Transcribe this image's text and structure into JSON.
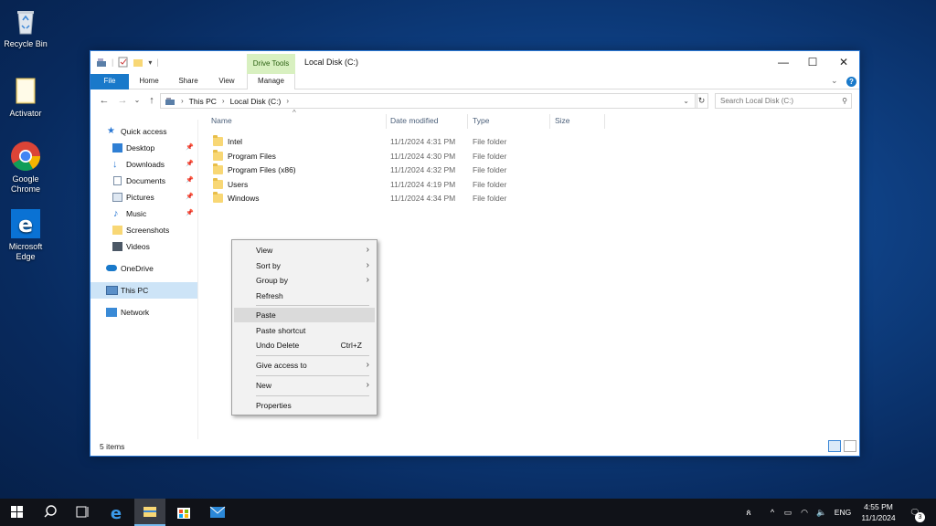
{
  "desktop": {
    "icons": [
      {
        "label": "Recycle Bin"
      },
      {
        "label": "Activator"
      },
      {
        "label": "Google Chrome"
      },
      {
        "label": "Microsoft Edge"
      }
    ]
  },
  "window": {
    "title": "Local Disk (C:)",
    "drive_tools_label": "Drive Tools",
    "controls": {
      "minimize": "—",
      "maximize": "☐",
      "close": "✕"
    },
    "ribbon_tabs": [
      {
        "label": "File"
      },
      {
        "label": "Home"
      },
      {
        "label": "Share"
      },
      {
        "label": "View"
      },
      {
        "label": "Manage"
      }
    ],
    "help_icon": "?",
    "breadcrumb": [
      "This PC",
      "Local Disk (C:)"
    ],
    "search_placeholder": "Search Local Disk (C:)"
  },
  "navpane": {
    "quick_access": "Quick access",
    "items": [
      {
        "label": "Desktop",
        "pinned": true
      },
      {
        "label": "Downloads",
        "pinned": true
      },
      {
        "label": "Documents",
        "pinned": true
      },
      {
        "label": "Pictures",
        "pinned": true
      },
      {
        "label": "Music",
        "pinned": true
      },
      {
        "label": "Screenshots",
        "pinned": false
      },
      {
        "label": "Videos",
        "pinned": false
      }
    ],
    "onedrive": "OneDrive",
    "this_pc": "This PC",
    "network": "Network"
  },
  "columns": {
    "name": "Name",
    "date": "Date modified",
    "type": "Type",
    "size": "Size"
  },
  "files": [
    {
      "name": "Intel",
      "date": "11/1/2024 4:31 PM",
      "type": "File folder"
    },
    {
      "name": "Program Files",
      "date": "11/1/2024 4:30 PM",
      "type": "File folder"
    },
    {
      "name": "Program Files (x86)",
      "date": "11/1/2024 4:32 PM",
      "type": "File folder"
    },
    {
      "name": "Users",
      "date": "11/1/2024 4:19 PM",
      "type": "File folder"
    },
    {
      "name": "Windows",
      "date": "11/1/2024 4:34 PM",
      "type": "File folder"
    }
  ],
  "status": {
    "item_count": "5 items"
  },
  "context_menu": {
    "view": "View",
    "sort_by": "Sort by",
    "group_by": "Group by",
    "refresh": "Refresh",
    "paste": "Paste",
    "paste_shortcut": "Paste shortcut",
    "undo_delete": "Undo Delete",
    "undo_shortcut": "Ctrl+Z",
    "give_access": "Give access to",
    "new": "New",
    "properties": "Properties"
  },
  "taskbar": {
    "language": "ENG",
    "time": "4:55 PM",
    "date": "11/1/2024",
    "notification_count": "3"
  },
  "colors": {
    "accent": "#1979ca",
    "drive_tools_bg": "#d8f0c0",
    "selection": "#cde4f7"
  }
}
